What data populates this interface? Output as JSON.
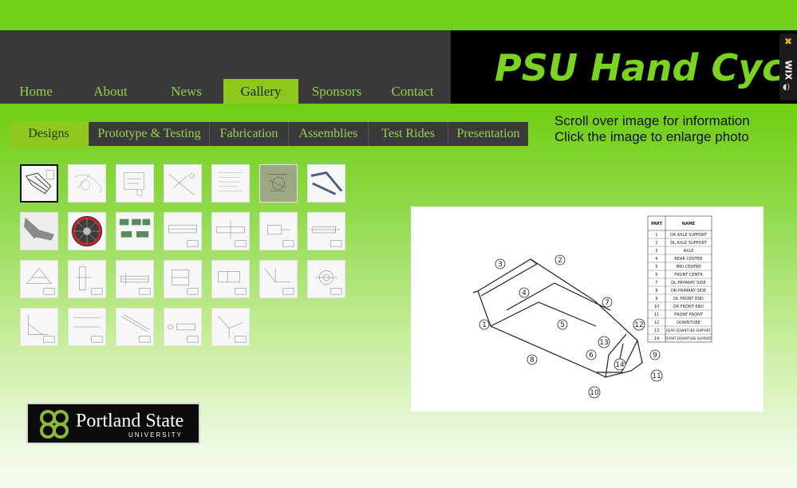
{
  "site": {
    "title": "PSU Hand Cycle"
  },
  "nav": {
    "items": [
      {
        "label": "Home"
      },
      {
        "label": "About"
      },
      {
        "label": "News"
      },
      {
        "label": "Gallery",
        "active": true
      },
      {
        "label": "Sponsors"
      },
      {
        "label": "Contact"
      }
    ]
  },
  "wix_badge": {
    "label": "WIX"
  },
  "subnav": {
    "items": [
      {
        "label": "Designs",
        "active": true
      },
      {
        "label": "Prototype & Testing"
      },
      {
        "label": "Fabrication"
      },
      {
        "label": "Assemblies"
      },
      {
        "label": "Test Rides"
      },
      {
        "label": "Presentation"
      }
    ]
  },
  "instructions": {
    "line1": "Scroll over image for information",
    "line2": "Click the image to enlarge photo"
  },
  "gallery": {
    "thumbnail_count": 26,
    "selected_index": 0
  },
  "preview_drawing": {
    "table_headers": [
      "PART",
      "NAME"
    ],
    "parts": [
      {
        "num": "1",
        "name": "DR AXLE SUPPORT"
      },
      {
        "num": "2",
        "name": "DL AXLE SUPPORT"
      },
      {
        "num": "3",
        "name": "AXLE"
      },
      {
        "num": "4",
        "name": "REAR CENTER"
      },
      {
        "num": "5",
        "name": "MID CENTER"
      },
      {
        "num": "6",
        "name": "FRONT CENTR"
      },
      {
        "num": "7",
        "name": "DL PRIMARY SIDE"
      },
      {
        "num": "8",
        "name": "DR PRIMARY SIDE"
      },
      {
        "num": "9",
        "name": "DL FRONT END"
      },
      {
        "num": "10",
        "name": "DR FRONT END"
      },
      {
        "num": "11",
        "name": "FRONT FRONT"
      },
      {
        "num": "12",
        "name": "DOWNTUBE"
      },
      {
        "num": "13",
        "name": "REAR DOWNTUBE SUPPORT"
      },
      {
        "num": "14",
        "name": "FRONT DOWNTUBE SUPPORT"
      }
    ],
    "balloons": [
      "1",
      "2",
      "3",
      "4",
      "5",
      "6",
      "7",
      "8",
      "9",
      "10",
      "11",
      "12",
      "13",
      "14"
    ]
  },
  "footer_logo": {
    "line1": "Portland State",
    "line2": "UNIVERSITY"
  },
  "colors": {
    "brand_green": "#72d017",
    "header_dark": "#3a3a3a",
    "active_tab": "#8ec71e"
  }
}
